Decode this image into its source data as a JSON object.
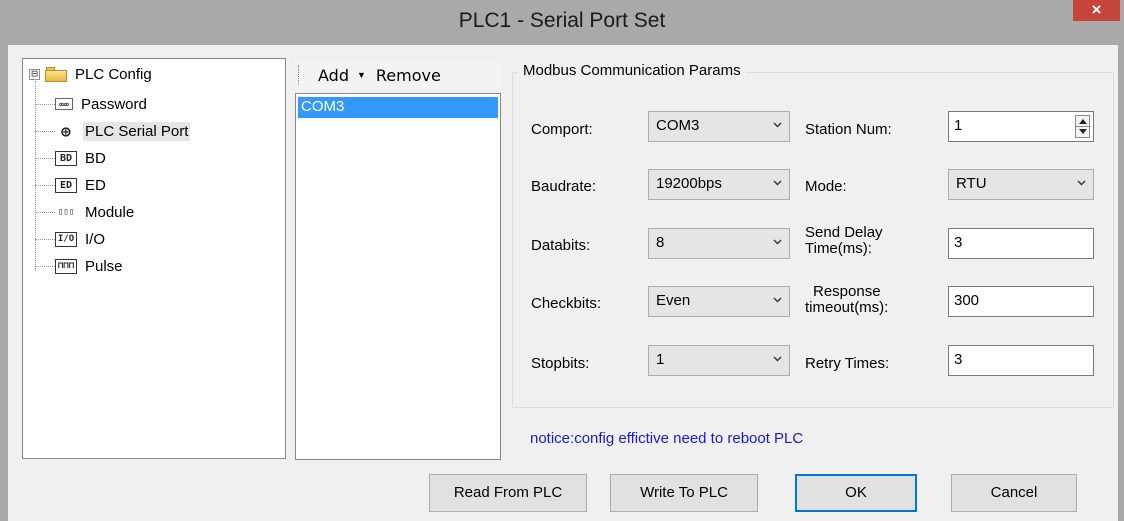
{
  "window": {
    "title": "PLC1 - Serial Port  Set",
    "close_label": "×"
  },
  "tree": {
    "root_label": "PLC Config",
    "expander": "⊟",
    "items": [
      {
        "label": "Password",
        "icon": "password-icon",
        "icon_text": "∞∞"
      },
      {
        "label": "PLC Serial Port",
        "icon": "serial-port-icon",
        "icon_text": "⊕"
      },
      {
        "label": "BD",
        "icon": "bd-icon",
        "icon_text": "BD"
      },
      {
        "label": "ED",
        "icon": "ed-icon",
        "icon_text": "ED"
      },
      {
        "label": "Module",
        "icon": "module-icon",
        "icon_text": "▯▯▯"
      },
      {
        "label": "I/O",
        "icon": "io-icon",
        "icon_text": "I/O"
      },
      {
        "label": "Pulse",
        "icon": "pulse-icon",
        "icon_text": "⊓⊓⊓"
      }
    ]
  },
  "com_toolbar": {
    "add_label": "Add",
    "caret": "▼",
    "remove_label": "Remove"
  },
  "com_list": {
    "items": [
      "COM3"
    ]
  },
  "params": {
    "group_title": "Modbus Communication Params",
    "comport": {
      "label": "Comport:",
      "value": "COM3"
    },
    "baudrate": {
      "label": "Baudrate:",
      "value": "19200bps"
    },
    "databits": {
      "label": "Databits:",
      "value": "8"
    },
    "checkbits": {
      "label": "Checkbits:",
      "value": "Even"
    },
    "stopbits": {
      "label": "Stopbits:",
      "value": "1"
    },
    "station_num": {
      "label": "Station Num:",
      "value": "1"
    },
    "mode": {
      "label": "Mode:",
      "value": "RTU"
    },
    "send_delay": {
      "label_line1": "Send Delay",
      "label_line2": "Time(ms):",
      "value": "3"
    },
    "response_timeout": {
      "label_line1": "Response",
      "label_line2": "timeout(ms):",
      "value": "300"
    },
    "retry_times": {
      "label": "Retry Times:",
      "value": "3"
    }
  },
  "notice": "notice:config effictive need to reboot PLC",
  "buttons": {
    "read": "Read From PLC",
    "write": "Write To PLC",
    "ok": "OK",
    "cancel": "Cancel"
  },
  "colors": {
    "selection": "#3399ff",
    "notice": "#1a1ad6",
    "close": "#c7443b",
    "default_button_border": "#0078d7"
  }
}
